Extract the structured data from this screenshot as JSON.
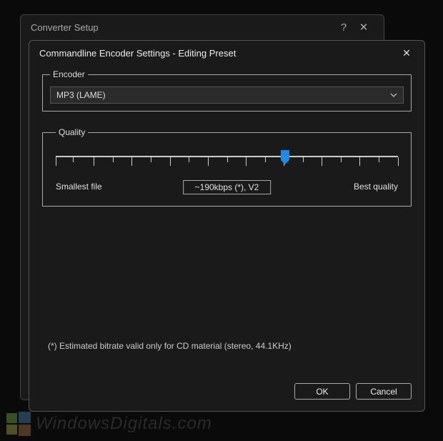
{
  "parent": {
    "title": "Converter Setup",
    "help_label": "?",
    "close_label": "✕"
  },
  "dialog": {
    "title": "Commandline Encoder Settings - Editing Preset",
    "close_label": "✕"
  },
  "encoder": {
    "legend": "Encoder",
    "value": "MP3 (LAME)"
  },
  "quality": {
    "legend": "Quality",
    "min_label": "Smallest file",
    "max_label": "Best quality",
    "current_label": "~190kbps (*), V2",
    "slider_percent": 67
  },
  "footnote": "(*) Estimated bitrate valid only for CD material (stereo, 44.1KHz)",
  "buttons": {
    "ok": "OK",
    "cancel": "Cancel"
  },
  "watermark": {
    "text": "WindowsDigitals.com"
  }
}
